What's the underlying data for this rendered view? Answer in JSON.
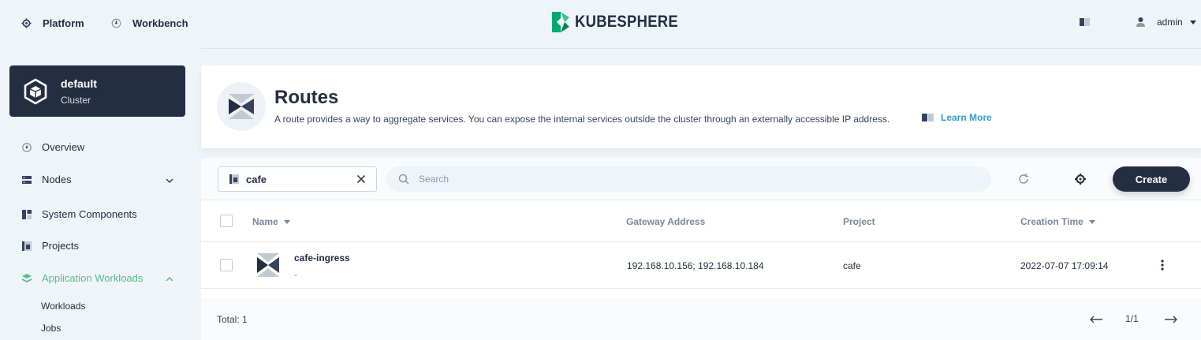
{
  "topnav": {
    "platform_label": "Platform",
    "workbench_label": "Workbench",
    "logo_text": "KUBESPHERE",
    "user_label": "admin",
    "icons": {
      "platform": "gear-icon",
      "workbench": "workbench-icon",
      "docs": "book-icon",
      "user": "user-icon"
    }
  },
  "sidebar": {
    "cluster": {
      "name": "default",
      "type": "Cluster"
    },
    "items": [
      {
        "label": "Overview",
        "icon": "dashboard-icon"
      },
      {
        "label": "Nodes",
        "icon": "nodes-icon",
        "expandable": true,
        "expanded": false
      },
      {
        "label": "System Components",
        "icon": "components-icon"
      },
      {
        "label": "Projects",
        "icon": "project-icon"
      },
      {
        "label": "Application Workloads",
        "icon": "workloads-icon",
        "expandable": true,
        "expanded": true,
        "active": true
      }
    ],
    "subitems": [
      "Workloads",
      "Jobs"
    ]
  },
  "banner": {
    "title": "Routes",
    "description": "A route provides a way to aggregate services. You can expose the internal services outside the cluster through an externally accessible IP address.",
    "learn_more": "Learn More"
  },
  "toolbar": {
    "namespace_value": "cafe",
    "search_placeholder": "Search",
    "create_label": "Create"
  },
  "table": {
    "columns": [
      "Name",
      "Gateway Address",
      "Project",
      "Creation Time"
    ],
    "rows": [
      {
        "name": "cafe-ingress",
        "description": "-",
        "gateway_address": "192.168.10.156; 192.168.10.184",
        "project": "cafe",
        "creation_time": "2022-07-07 17:09:14"
      }
    ]
  },
  "footer": {
    "total": "Total: 1",
    "page": "1/1"
  },
  "colors": {
    "accent_green": "#55bc8a",
    "link_blue": "#329dce",
    "dark": "#242e42",
    "background": "#eff4f9"
  }
}
